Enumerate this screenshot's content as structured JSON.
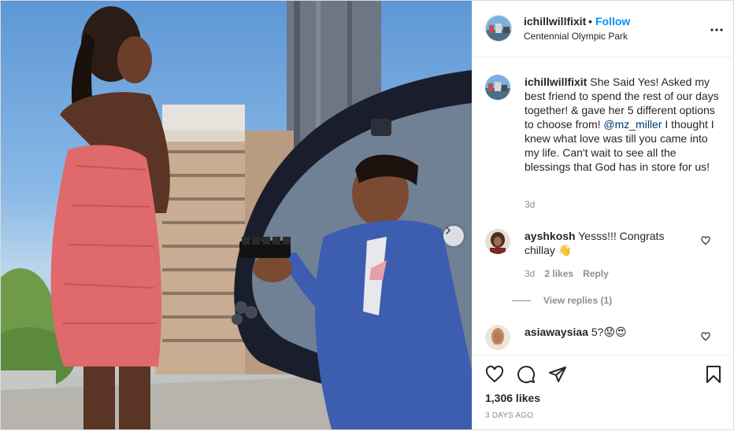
{
  "post": {
    "username": "ichillwillfixit",
    "follow_label": "Follow",
    "dot": "•",
    "location": "Centennial Olympic Park",
    "caption_username": "ichillwillfixit",
    "caption_part1": "She Said Yes! Asked my best friend to spend the rest of our days together! & gave her 5 different options to choose from!",
    "caption_mention": "@mz_miller",
    "caption_part2": "I thought I knew what love was till you came into my life. Can't wait to see all the blessings that God has in store for us!",
    "caption_time": "3d",
    "likes": "1,306 likes",
    "posted": "3 DAYS AGO"
  },
  "comments": [
    {
      "username": "ayshkosh",
      "text": "Yesss!!! Congrats chillay",
      "emoji": "👋",
      "time": "3d",
      "likes": "2 likes",
      "reply": "Reply",
      "view_replies": "View replies (1)"
    },
    {
      "username": "asiawaysiaa",
      "text": "5?",
      "emoji": "😟😍"
    }
  ],
  "icons": {
    "more": "more-options-icon",
    "like": "heart-icon",
    "comment": "comment-icon",
    "share": "paper-plane-icon",
    "save": "bookmark-icon",
    "next": "chevron-right-icon"
  },
  "colors": {
    "follow_blue": "#0095f6",
    "mention": "#00376b",
    "muted": "#8e8e8e",
    "border": "#dbdbdb"
  }
}
